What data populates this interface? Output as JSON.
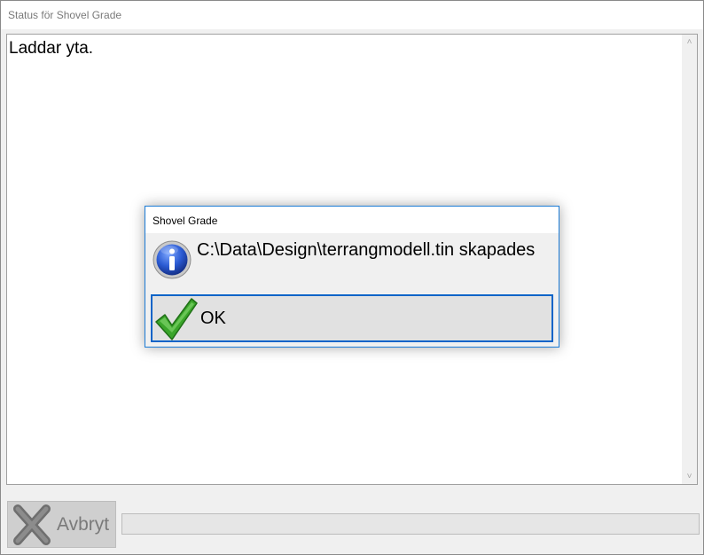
{
  "window": {
    "title": "Status för Shovel Grade"
  },
  "log": {
    "text": "Laddar yta."
  },
  "scrollbar": {
    "up_glyph": "˄",
    "down_glyph": "˅"
  },
  "footer": {
    "cancel_label": "Avbryt",
    "cancel_icon": "cancel-x-icon",
    "progress": 0
  },
  "dialog": {
    "title": "Shovel Grade",
    "icon": "info-icon",
    "message": "C:\\Data\\Design\\terrangmodell.tin skapades",
    "ok_label": "OK",
    "ok_icon": "checkmark-icon"
  },
  "colors": {
    "dialog_border": "#1c7cd6",
    "ok_focus_border": "#0a64c8",
    "check_green": "#3aa52a",
    "info_blue": "#1f4fc0"
  }
}
